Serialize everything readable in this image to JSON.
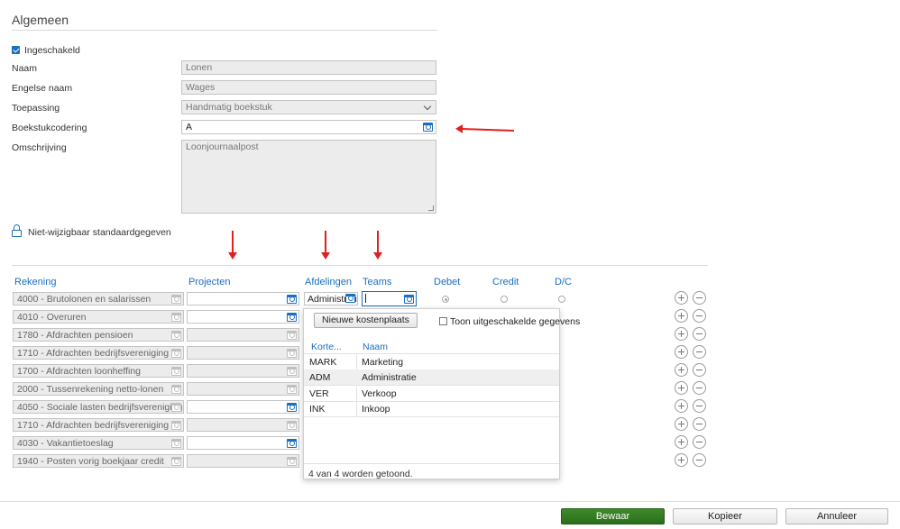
{
  "section": {
    "title": "Algemeen"
  },
  "form": {
    "enabled_label": "Ingeschakeld",
    "naam_label": "Naam",
    "naam_value": "Lonen",
    "engelse_naam_label": "Engelse naam",
    "engelse_naam_value": "Wages",
    "toepassing_label": "Toepassing",
    "toepassing_value": "Handmatig boekstuk",
    "boekstukcodering_label": "Boekstukcodering",
    "boekstukcodering_value": "A",
    "omschrijving_label": "Omschrijving",
    "omschrijving_value": "Loonjournaalpost",
    "locked_label": "Niet-wijzigbaar standaardgegeven"
  },
  "grid": {
    "headers": {
      "rekening": "Rekening",
      "projecten": "Projecten",
      "afdelingen": "Afdelingen",
      "teams": "Teams",
      "debet": "Debet",
      "credit": "Credit",
      "dc": "D/C"
    },
    "rows": [
      {
        "account": "4000 - Brutolonen en salarissen"
      },
      {
        "account": "4010 - Overuren"
      },
      {
        "account": "1780 - Afdrachten pensioen"
      },
      {
        "account": "1710 - Afdrachten bedrijfsvereniging"
      },
      {
        "account": "1700 - Afdrachten loonheffing"
      },
      {
        "account": "2000 - Tussenrekening netto-lonen"
      },
      {
        "account": "4050 - Sociale lasten bedrijfsvereniging"
      },
      {
        "account": "1710 - Afdrachten bedrijfsvereniging"
      },
      {
        "account": "4030 - Vakantietoeslag"
      },
      {
        "account": "1940 - Posten vorig boekjaar credit"
      }
    ],
    "afdeling_value": "Administratie"
  },
  "popup": {
    "new_button": "Nieuwe kostenplaats",
    "show_disabled": "Toon uitgeschakelde gegevens",
    "col_code": "Korte...",
    "col_name": "Naam",
    "items": [
      {
        "code": "MARK",
        "name": "Marketing"
      },
      {
        "code": "ADM",
        "name": "Administratie"
      },
      {
        "code": "VER",
        "name": "Verkoop"
      },
      {
        "code": "INK",
        "name": "Inkoop"
      }
    ],
    "footer": "4 van 4 worden getoond."
  },
  "actions": {
    "save": "Bewaar",
    "copy": "Kopieer",
    "cancel": "Annuleer"
  },
  "colors": {
    "accent": "#1a6fbf",
    "primary_button": "#2f7a1f",
    "annotation_arrow": "#e02020"
  }
}
